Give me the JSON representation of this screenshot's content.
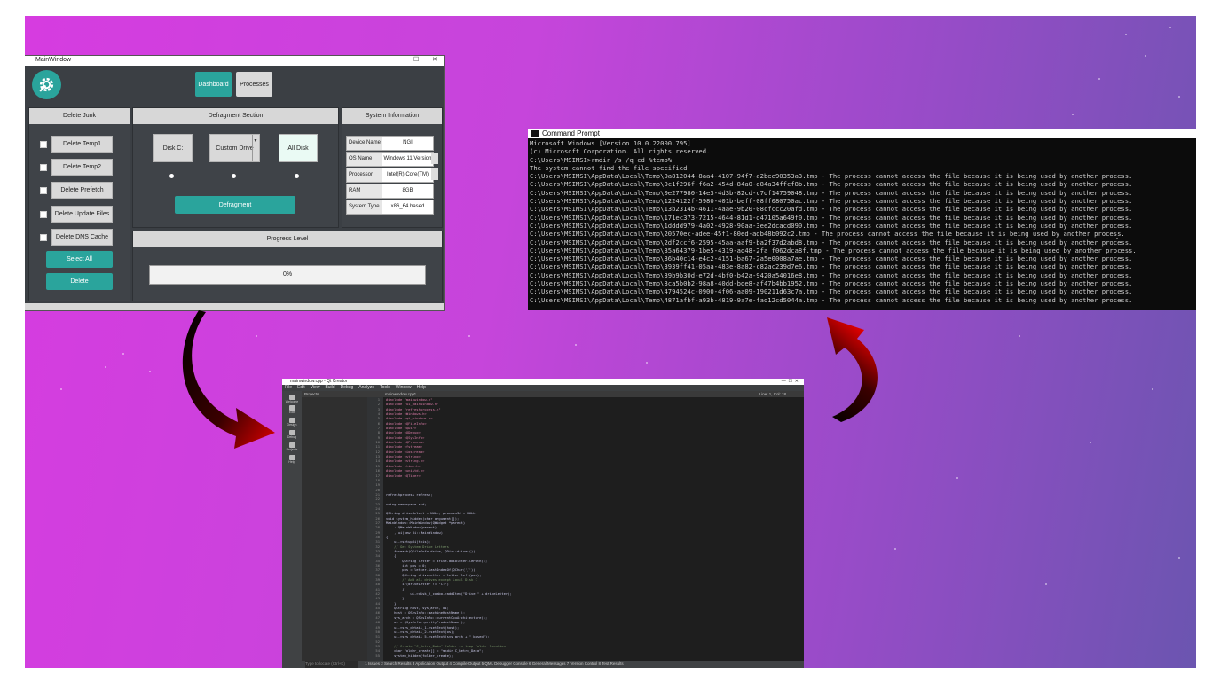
{
  "main_window": {
    "title": "MainWindow",
    "controls": [
      "—",
      "☐",
      "✕"
    ],
    "nav": {
      "dashboard": "Dashboard",
      "processes": "Processes"
    },
    "delete_junk": {
      "header": "Delete Junk",
      "items": [
        "Delete Temp1",
        "Delete Temp2",
        "Delete Prefetch",
        "Delete Update Files",
        "Delete DNS Cache"
      ],
      "select_all": "Select All",
      "delete": "Delete"
    },
    "defragment": {
      "header": "Defragment Section",
      "disk_c": "Disk C:",
      "custom_drive": "Custom Drive",
      "all_disk": "All Disk",
      "button": "Defragment"
    },
    "system_info": {
      "header": "System Information",
      "rows": [
        {
          "label": "Device Name",
          "value": "NGI"
        },
        {
          "label": "OS Name",
          "value": "Windows 11 Version"
        },
        {
          "label": "Processor",
          "value": "Intel(R) Core(TM)"
        },
        {
          "label": "RAM",
          "value": "8GB"
        },
        {
          "label": "System Type",
          "value": "x86_64 based"
        }
      ]
    },
    "progress": {
      "header": "Progress Level",
      "value_text": "0%",
      "fraction": 0
    }
  },
  "command_prompt": {
    "title": "Command Prompt",
    "lines": [
      "Microsoft Windows [Version 10.0.22000.795]",
      "(c) Microsoft Corporation. All rights reserved.",
      "",
      "C:\\Users\\MSIMSI>rmdir /s /q cd %temp%",
      "The system cannot find the file specified.",
      "C:\\Users\\MSIMSI\\AppData\\Local\\Temp\\0a812044-8aa4-4107-94f7-a2bee90353a3.tmp - The process cannot access the file because it is being used by another process.",
      "C:\\Users\\MSIMSI\\AppData\\Local\\Temp\\0c1f296f-f6a2-454d-84a0-d84a34ffcf8b.tmp - The process cannot access the file because it is being used by another process.",
      "C:\\Users\\MSIMSI\\AppData\\Local\\Temp\\0e277980-14e3-4d3b-82cd-c7df14759048.tmp - The process cannot access the file because it is being used by another process.",
      "C:\\Users\\MSIMSI\\AppData\\Local\\Temp\\1224122f-5980-401b-beff-08ff080750ac.tmp - The process cannot access the file because it is being used by another process.",
      "C:\\Users\\MSIMSI\\AppData\\Local\\Temp\\13b2314b-4611-4aae-9b20-08cfccc20afd.tmp - The process cannot access the file because it is being used by another process.",
      "C:\\Users\\MSIMSI\\AppData\\Local\\Temp\\171ec373-7215-4644-81d1-d47105a649f0.tmp - The process cannot access the file because it is being used by another process.",
      "C:\\Users\\MSIMSI\\AppData\\Local\\Temp\\1dddd979-4a02-4928-90aa-3ee2dcacd090.tmp - The process cannot access the file because it is being used by another process.",
      "C:\\Users\\MSIMSI\\AppData\\Local\\Temp\\20570ec-adee-45f1-80ed-adb48b092c2.tmp - The process cannot access the file because it is being used by another process.",
      "C:\\Users\\MSIMSI\\AppData\\Local\\Temp\\2df2ccf6-2595-45aa-aaf9-ba2f37d2abd8.tmp - The process cannot access the file because it is being used by another process.",
      "C:\\Users\\MSIMSI\\AppData\\Local\\Temp\\35a64379-1be5-4319-ad48-2fa f062dca8f.tmp - The process cannot access the file because it is being used by another process.",
      "C:\\Users\\MSIMSI\\AppData\\Local\\Temp\\36b40c14-e4c2-4151-ba67-2a5e0008a7ae.tmp - The process cannot access the file because it is being used by another process.",
      "C:\\Users\\MSIMSI\\AppData\\Local\\Temp\\3939ff41-05aa-483e-8a82-c82ac239d7e6.tmp - The process cannot access the file because it is being used by another process.",
      "C:\\Users\\MSIMSI\\AppData\\Local\\Temp\\39b9b30d-e72d-4bf0-b42a-9420a54016e8.tmp - The process cannot access the file because it is being used by another process.",
      "C:\\Users\\MSIMSI\\AppData\\Local\\Temp\\3ca5b0b2-98a8-40dd-bde8-af47b4bb1952.tmp - The process cannot access the file because it is being used by another process.",
      "C:\\Users\\MSIMSI\\AppData\\Local\\Temp\\4794524c-0900-4f06-aa09-190211d63c7a.tmp - The process cannot access the file because it is being used by another process.",
      "C:\\Users\\MSIMSI\\AppData\\Local\\Temp\\4871afbf-a93b-4819-9a7e-fad12cd5044a.tmp - The process cannot access the file because it is being used by another process."
    ]
  },
  "qt_creator": {
    "title": "mainwindow.cpp - Qt Creator",
    "menu": [
      "File",
      "Edit",
      "View",
      "Build",
      "Debug",
      "Analyze",
      "Tools",
      "Window",
      "Help"
    ],
    "modes": [
      "Welcome",
      "Edit",
      "Design",
      "Debug",
      "Projects",
      "Help"
    ],
    "projects_label": "Projects",
    "tab": "mainwindow.cpp*",
    "editor_info": "Line: 1, Col: 18",
    "locator": "Type to locate (Ctrl+K)",
    "status_tabs": "1 Issues  2 Search Results  3 Application Output  4 Compile Output  5 QML Debugger Console  6 General Messages  7 Version Control  8 Test Results",
    "code": [
      "#include \"mainwindow.h\"",
      "#include \"ui_mainwindow.h\"",
      "#include \"refreshprocess.h\"",
      "#include <Windows.h>",
      "#include <qt_windows.h>",
      "#include <QFileInfo>",
      "#include <QDir>",
      "#include <QDebug>",
      "#include <QSysInfo>",
      "#include <QProcess>",
      "#include <fstream>",
      "#include <iostream>",
      "#include <string>",
      "#include <string.h>",
      "#include <time.h>",
      "#include <unistd.h>",
      "#include <QTimer>",
      "",
      "",
      "",
      "refreshprocess refresh;",
      "",
      "using namespace std;",
      "",
      "QString driveSelect = NULL, processId = NULL;",
      "void system_hidden(char argument[]);",
      "MainWindow::MainWindow(QWidget *parent)",
      "    : QMainWindow(parent)",
      "    , ui(new Ui::MainWindow)",
      "{",
      "    ui->setupUi(this);",
      "    // Get System Drive Letters",
      "    foreach(QFileInfo drive, QDir::drives())",
      "    {",
      "        QString letter = drive.absoluteFilePath();",
      "        int pos = 0;",
      "        pos = letter.lastIndexOf(QChar('/'));",
      "        QString driveLetter = letter.left(pos);",
      "        // Add all drives except Local Disk C",
      "        if(driveLetter != \"C:\")",
      "        {",
      "            ui->disk_2_combo->addItem(\"Drive \" + driveLetter);",
      "        }",
      "    }",
      "    QString host, sys_arch, os;",
      "    host = QSysInfo::machineHostName();",
      "    sys_arch = QSysInfo::currentCpuArchitecture();",
      "    os = QSysInfo::prettyProductName();",
      "    ui->sys_detail_1->setText(host);",
      "    ui->sys_detail_2->setText(os);",
      "    ui->sys_detail_5->setText(sys_arch + \" based\");",
      "",
      "    // Create \"C_Retro_Data\" folder in temp folder location",
      "    char folder_create[] = \"mkdir C_Retro_Data\";",
      "    system_hidden(folder_create);"
    ]
  }
}
